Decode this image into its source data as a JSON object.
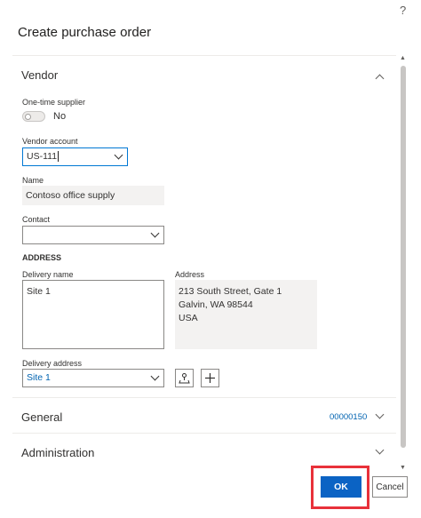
{
  "dialog": {
    "help_glyph": "?",
    "title": "Create purchase order"
  },
  "vendor_section": {
    "header": "Vendor",
    "one_time_supplier": {
      "label": "One-time supplier",
      "value": "No",
      "enabled": false
    },
    "vendor_account": {
      "label": "Vendor account",
      "value": "US-111"
    },
    "name": {
      "label": "Name",
      "value": "Contoso office supply"
    },
    "contact": {
      "label": "Contact",
      "value": ""
    },
    "address_heading": "ADDRESS",
    "delivery_name": {
      "label": "Delivery name",
      "value": "Site 1"
    },
    "address": {
      "label": "Address",
      "lines": [
        "213 South Street, Gate 1",
        "Galvin, WA 98544",
        "USA"
      ]
    },
    "delivery_address": {
      "label": "Delivery address",
      "value": "Site 1"
    },
    "icons": {
      "address_action": "map-pin-icon",
      "add": "plus-icon"
    }
  },
  "general_section": {
    "header": "General",
    "summary": "00000150"
  },
  "administration_section": {
    "header": "Administration"
  },
  "footer": {
    "ok_label": "OK",
    "cancel_label": "Cancel"
  },
  "colors": {
    "accent": "#0b63c4",
    "link": "#0063b1",
    "highlight": "#e8313a",
    "readonly_bg": "#f3f2f1"
  }
}
